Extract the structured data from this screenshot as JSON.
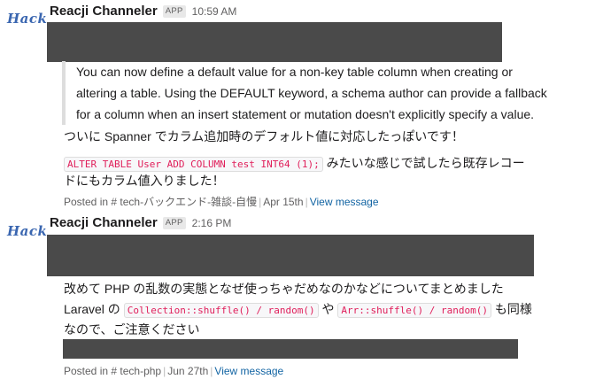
{
  "messages": [
    {
      "avatar_text": "Hack",
      "sender": "Reacji Channeler",
      "badge": "APP",
      "time": "10:59 AM",
      "quote_lines": [
        "You can now define a default value for a non-key table column when creating or",
        "altering a table. Using the DEFAULT keyword, a schema author can provide a fallback",
        "for a column when an insert statement or mutation doesn't explicitly specify a value."
      ],
      "line1": "ついに Spanner でカラム追加時のデフォルト値に対応したっぽいです！",
      "code": "ALTER TABLE User ADD COLUMN test INT64 (1);",
      "line2_after": " みたいな感じで試したら既存レコー",
      "line3": "ドにもカラム値入りました！",
      "footer_prefix": "Posted in",
      "channel": "# tech-バックエンド-雑談-自慢",
      "date": "Apr 15th",
      "view": "View message"
    },
    {
      "avatar_text": "Hack",
      "sender": "Reacji Channeler",
      "badge": "APP",
      "time": "2:16 PM",
      "line1": "改めて PHP の乱数の実態となぜ使っちゃだめなのかなどについてまとめました",
      "line2_before": "Laravel の ",
      "code1": "Collection::shuffle() / random()",
      "line2_mid": " や ",
      "code2": "Arr::shuffle() / random()",
      "line2_after": " も同様",
      "line3": "なので、ご注意ください",
      "footer_prefix": "Posted in",
      "channel": "# tech-php",
      "date": "Jun 27th",
      "view": "View message"
    }
  ]
}
